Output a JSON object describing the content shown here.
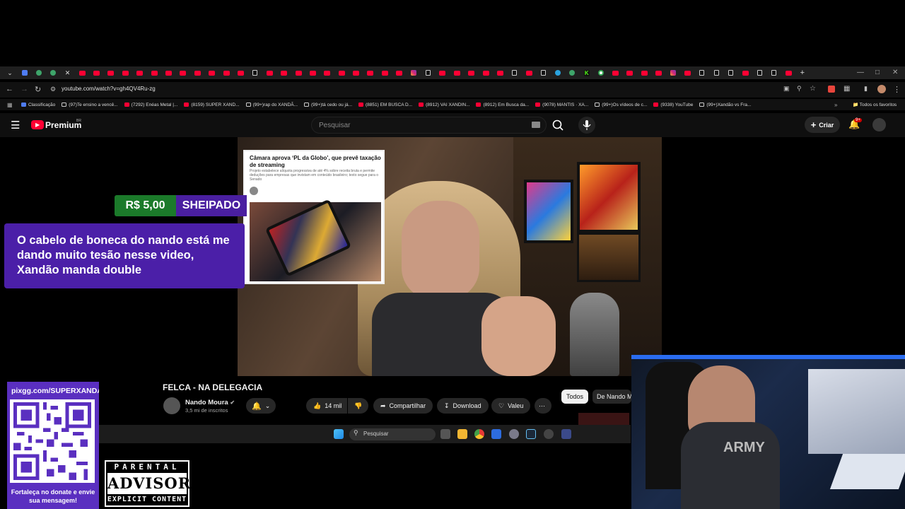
{
  "browser": {
    "url": "youtube.com/watch?v=gh4QV4Ru-zg",
    "bookmarks": [
      {
        "label": "Classificação",
        "icon": "classification-icon"
      },
      {
        "label": "(97)Te ensino a vencê...",
        "icon": "tiktok-icon"
      },
      {
        "label": "(7292) Enéas Metal |...",
        "icon": "youtube-icon"
      },
      {
        "label": "(8159) SUPER XAND...",
        "icon": "youtube-icon"
      },
      {
        "label": "(99+)rap do XANDÃ...",
        "icon": "tiktok-icon"
      },
      {
        "label": "(99+)tá cedo ou já...",
        "icon": "tiktok-icon"
      },
      {
        "label": "(8851) EM BUSCA D...",
        "icon": "youtube-icon"
      },
      {
        "label": "(8912) VAI XANDIN...",
        "icon": "youtube-icon"
      },
      {
        "label": "(8912) Em Busca da...",
        "icon": "youtube-icon"
      },
      {
        "label": "(9078) MANTIS · XA...",
        "icon": "youtube-icon"
      },
      {
        "label": "(99+)Os vídeos de c...",
        "icon": "tiktok-icon"
      },
      {
        "label": "(9338) YouTube",
        "icon": "youtube-icon"
      },
      {
        "label": "(99+)Xandão vs Fra...",
        "icon": "tiktok-icon"
      }
    ],
    "all_bookmarks_label": "Todos os favoritos"
  },
  "youtube": {
    "logo_text": "Premium",
    "logo_region": "BR",
    "search_placeholder": "Pesquisar",
    "create_label": "Criar",
    "notification_badge": "9+",
    "video": {
      "article_title": "Câmara aprova ‘PL da Globo’, que prevê taxação de streaming",
      "article_subtitle": "Projeto estabelece alíquota progressiva de até 4% sobre receita bruta e permite deduções para empresas que invistam em conteúdo brasileiro; texto segue para o Senado"
    },
    "title": "FELCA - NA DELEGACIA",
    "channel_name": "Nando Moura",
    "channel_subs": "3,5 mi de inscritos",
    "likes": "14 mil",
    "share_label": "Compartilhar",
    "download_label": "Download",
    "thanks_label": "Valeu",
    "filter_all": "Todos",
    "filter_channel": "De Nando Moura"
  },
  "donation": {
    "amount": "R$ 5,00",
    "user": "SHEIPADO",
    "message": "O cabelo de boneca do nando está me dando muito tesão nesse video, Xandão manda double"
  },
  "taskbar": {
    "search_placeholder": "Pesquisar"
  },
  "overlay": {
    "qr_url": "pixgg.com/SUPERXANDAO",
    "qr_text": "Fortaleça no donate e envie sua mensagem!",
    "pa_top": "PARENTAL",
    "pa_mid": "ADVISORY",
    "pa_bottom": "EXPLICIT CONTENT",
    "shirt_text": "ARMY"
  },
  "colors": {
    "youtube_red": "#ff0033",
    "donation_green": "#1b7a2a",
    "donation_purple": "#4b1fa8",
    "qr_purple": "#5a2fc0"
  }
}
